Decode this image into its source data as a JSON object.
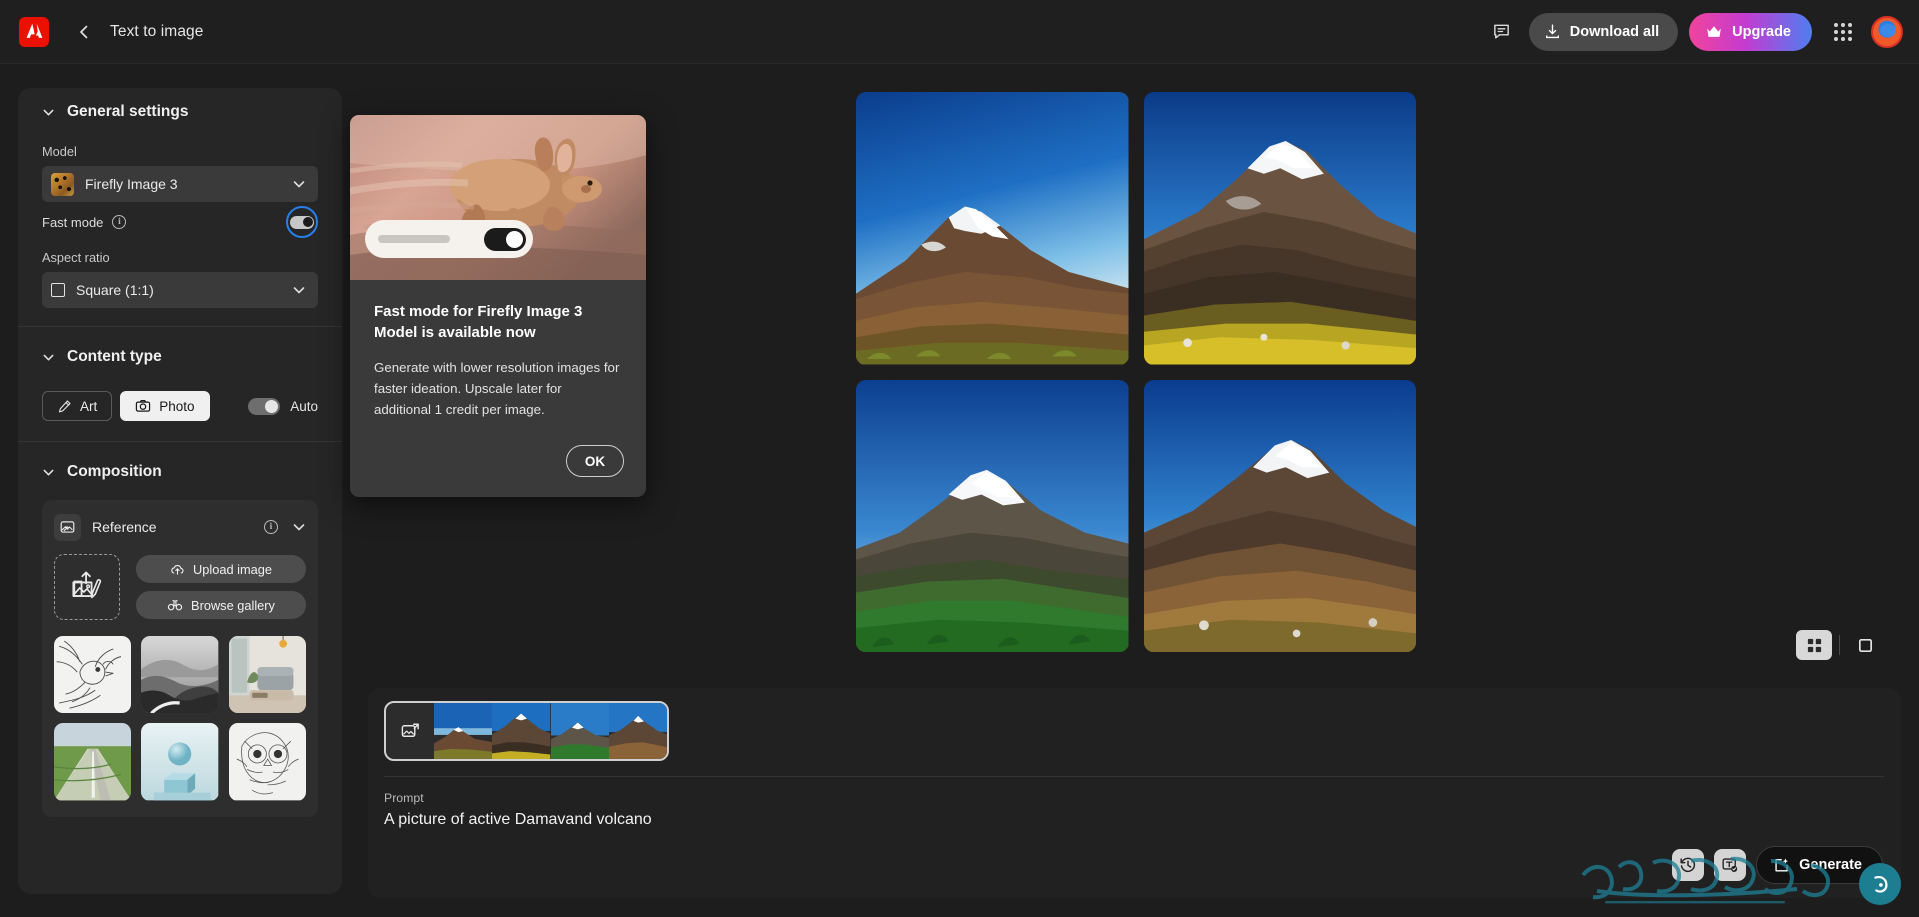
{
  "topbar": {
    "brand_icon": "adobe-logo-icon",
    "back_icon": "chevron-left-icon",
    "title": "Text to image",
    "feedback_icon": "feedback-bubble-icon",
    "download_label": "Download all",
    "download_icon": "download-icon",
    "upgrade_label": "Upgrade",
    "upgrade_icon": "crown-icon",
    "apps_icon": "app-grid-icon",
    "avatar_icon": "user-avatar"
  },
  "sidebar": {
    "general": {
      "title": "General settings",
      "collapse_icon": "chevron-down-icon",
      "model_label": "Model",
      "model_value": "Firefly Image 3",
      "model_chevron": "chevron-down-icon",
      "fast_mode_label": "Fast mode",
      "fast_mode_info_icon": "info-icon",
      "fast_mode_state": "on",
      "aspect_label": "Aspect ratio",
      "aspect_value": "Square (1:1)",
      "aspect_icon": "square-icon",
      "aspect_chevron": "chevron-down-icon"
    },
    "content_type": {
      "title": "Content type",
      "collapse_icon": "chevron-down-icon",
      "art_label": "Art",
      "art_icon": "art-brush-icon",
      "photo_label": "Photo",
      "photo_icon": "camera-icon",
      "selected": "Photo",
      "auto_label": "Auto",
      "auto_state": "off"
    },
    "composition": {
      "title": "Composition",
      "collapse_icon": "chevron-down-icon",
      "reference_label": "Reference",
      "reference_icon": "image-reference-icon",
      "reference_info_icon": "info-icon",
      "reference_chevron": "chevron-down-icon",
      "dropzone_icon": "upload-image-placeholder-icon",
      "upload_label": "Upload image",
      "upload_icon": "cloud-upload-icon",
      "browse_label": "Browse gallery",
      "browse_icon": "binoculars-icon",
      "gallery_thumbs": [
        "sketch-blue-jay",
        "grayscale-river-valley",
        "living-room-interior",
        "country-road-fields",
        "pastel-sphere-cube",
        "sketch-owl"
      ]
    }
  },
  "results": {
    "images": [
      "damavand-volcano-wide-plain",
      "damavand-volcano-dark-ridge",
      "damavand-volcano-green-valley",
      "damavand-volcano-golden-slope"
    ],
    "view_toggles": [
      {
        "name": "grid-view-toggle",
        "icon": "grid-2x2-icon",
        "selected": true
      },
      {
        "name": "single-view-toggle",
        "icon": "square-outline-icon",
        "selected": false
      }
    ]
  },
  "prompt_bar": {
    "filmstrip_icon": "image-stack-icon",
    "filmstrip_thumbs": [
      "damavand-volcano-wide-plain",
      "damavand-volcano-dark-ridge",
      "damavand-volcano-green-valley",
      "damavand-volcano-golden-slope"
    ],
    "prompt_label": "Prompt",
    "prompt_value": "A picture of active Damavand volcano",
    "history_icon": "history-clock-icon",
    "text_effects_icon": "text-template-icon",
    "generate_label": "Generate",
    "generate_icon": "sparkle-generate-icon"
  },
  "popover": {
    "image": "running-rabbit-illustration",
    "chip_toggle_state": "on",
    "title": "Fast mode for Firefly Image 3 Model is available now",
    "description": "Generate with lower resolution images for faster ideation. Upscale later for additional 1 credit per image.",
    "ok_label": "OK"
  },
  "colors": {
    "page_bg": "#1d1d1d",
    "panel_bg": "#262626",
    "accent_blue": "#2680eb",
    "adobe_red": "#eb1000",
    "upgrade_gradient_from": "#f0449c",
    "upgrade_gradient_to": "#4e7ef0",
    "watermark_teal": "#1d7d91"
  }
}
